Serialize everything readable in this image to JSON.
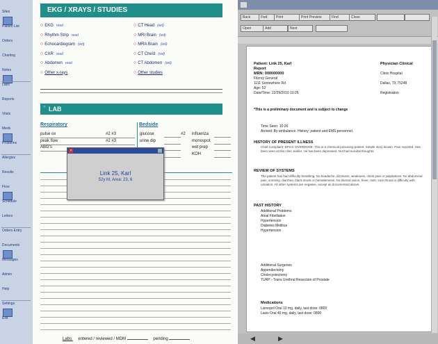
{
  "sidebar": {
    "items": [
      "Sites",
      "Patient List",
      "Orders",
      "Charting",
      "Notes",
      "Labs",
      "Reports",
      "Vitals",
      "Meds",
      "Problems",
      "Allergies",
      "Results",
      "Flow",
      "Schedule",
      "Letters",
      "Orders Entry",
      "Documents",
      "Messages",
      "Admin",
      "Help",
      "Settings",
      "Exit"
    ]
  },
  "form": {
    "header_title": "EKG / XRAYS / STUDIES",
    "left_checks": [
      {
        "label": "EKG",
        "note": "read"
      },
      {
        "label": "Rhythm Strip",
        "note": "read"
      },
      {
        "label": "Echocardiogram",
        "note": "(wd)"
      },
      {
        "label": "CXR",
        "note": "read"
      },
      {
        "label": "Abdomen",
        "note": "read"
      },
      {
        "label": "Other x-rays",
        "note": ""
      }
    ],
    "right_checks": [
      {
        "label": "CT Head",
        "note": "(wd)"
      },
      {
        "label": "MRI Brain",
        "note": "(wd)"
      },
      {
        "label": "MRA Brain",
        "note": "(wd)"
      },
      {
        "label": "CT Chest",
        "note": "(wd)"
      },
      {
        "label": "CT Abdomen",
        "note": "(wd)"
      },
      {
        "label": "Other studies",
        "note": ""
      }
    ],
    "lab_title": "LAB",
    "respiratory_title": "Respiratory",
    "bedside_title": "Bedside",
    "resp_rows": [
      {
        "label": "pulse ox",
        "vals": "#2  #3"
      },
      {
        "label": "peak flow",
        "vals": "#2  #3"
      },
      {
        "label": "ABG's",
        "vals": ""
      }
    ],
    "bedside_rows": [
      {
        "a": "glucose",
        "b": "#2",
        "c": "influenza"
      },
      {
        "a": "urine dip",
        "b": "",
        "c": "monospot"
      },
      {
        "a": "",
        "b": "",
        "c": "wet prep"
      },
      {
        "a": "urisem",
        "b": "",
        "c": "KOH"
      }
    ],
    "footer_labs": "Labs:",
    "footer_status": "entered / reviewed / MDM",
    "footer_pending": "pending"
  },
  "popup": {
    "name": "Link 25, Karl",
    "details": "52y M, Area: 23, 6"
  },
  "viewer": {
    "toolbar_buttons": [
      "Back",
      "Fwd",
      "Print",
      "Print Preview",
      "Find",
      "Close",
      "Open",
      "Add",
      "Next"
    ],
    "patient_line": "Patient: Link 25, Karl",
    "report_title": "Physician Clinical",
    "report_label": "Report",
    "mrn": "MRN: 000000000",
    "facility": "Clinic Hospital",
    "addr1": "Fitzroy General",
    "addr2": "1111 Somewhere Rd",
    "addr3": "Dallas, TX 75248",
    "reg": "Registration",
    "age": "Age: 52",
    "date": "Date/Time: 12/29/2010 10:26",
    "disclaimer": "*This is a preliminary document and is subject to change",
    "time_seen": "Time Seen: 10:26",
    "arrival": "Arrived: By ambulance. History: patient and EMS personnel.",
    "hpi_title": "HISTORY OF PRESENT ILLNESS",
    "hpi_text": "Chief Complaint: EPIAC OVERDOSE. This is a chemical poisoning patient. Simple story known. Pain reported. Has been seen at this clinic earlier. He has been depressed. Not had suicidal thoughts.",
    "ros_title": "REVIEW OF SYSTEMS",
    "ros_text": "The patient has had difficulty breathing. No headache, dizziness, weakness, chest pain or palpitations. No abdominal pain, vomiting, diarrhea, black stools or hematemesis. No blurred vision, fever, rash, sore throat or difficulty with urination. All other systems are negative, except as documented above.",
    "pmh_title": "PAST HISTORY",
    "pmh_items": [
      "Additional Problems",
      "Atrial Fibrillation",
      "Hypertension",
      "Diabetes Mellitus",
      "Hypertension"
    ],
    "surg_items": [
      "Additional Surgeries",
      "Appendectomy",
      "Cholecystectomy",
      "TURP - Trans Urethral Resection of Prostate"
    ],
    "meds_title": "Medications",
    "meds_items": [
      "Lisinopril Oral 10 mg, daily, last dose: 0800",
      "Lasix Oral 40 mg, daily, last dose: 0800"
    ]
  }
}
